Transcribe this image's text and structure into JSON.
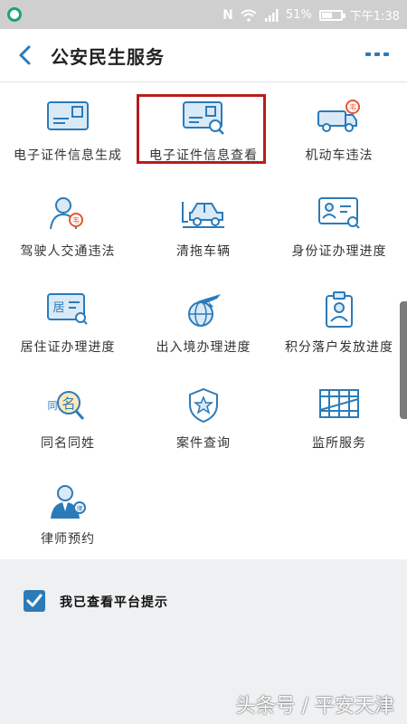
{
  "status_bar": {
    "battery": "51%",
    "time": "下午1:38"
  },
  "nav": {
    "title": "公安民生服务",
    "back_icon": "chevron-left-icon",
    "more_icon": "more-icon"
  },
  "services": [
    {
      "label": "电子证件信息生成",
      "icon": "id-card-icon"
    },
    {
      "label": "电子证件信息查看",
      "icon": "id-card-search-icon",
      "highlighted": true
    },
    {
      "label": "机动车违法",
      "icon": "truck-violation-icon"
    },
    {
      "label": "驾驶人交通违法",
      "icon": "driver-violation-icon"
    },
    {
      "label": "清拖车辆",
      "icon": "tow-vehicle-icon"
    },
    {
      "label": "身份证办理进度",
      "icon": "id-progress-icon"
    },
    {
      "label": "居住证办理进度",
      "icon": "residence-permit-icon"
    },
    {
      "label": "出入境办理进度",
      "icon": "globe-plane-icon"
    },
    {
      "label": "积分落户发放进度",
      "icon": "badge-person-icon"
    },
    {
      "label": "同名同姓",
      "icon": "name-search-icon"
    },
    {
      "label": "案件查询",
      "icon": "shield-star-icon"
    },
    {
      "label": "监所服务",
      "icon": "prison-bars-icon"
    },
    {
      "label": "律师预约",
      "icon": "lawyer-icon"
    }
  ],
  "agreement": {
    "label": "我已查看平台提示",
    "checked": true
  },
  "watermark": "头条号 / 平安天津",
  "colors": {
    "accent": "#2b7bb9",
    "warning": "#e4572e",
    "highlight": "#b71c1c"
  }
}
